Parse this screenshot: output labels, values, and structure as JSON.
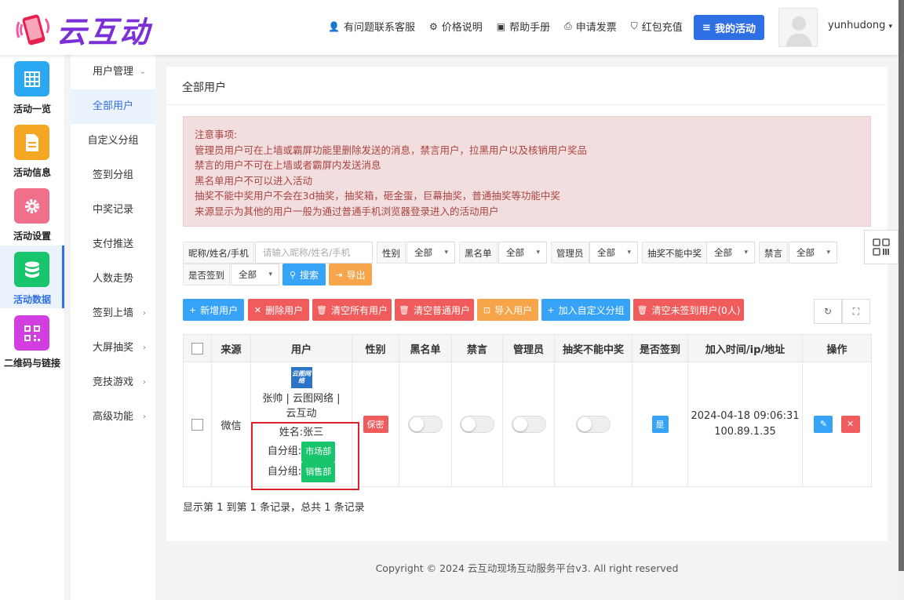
{
  "brand": {
    "name": "云互动"
  },
  "topnav": {
    "items": [
      {
        "label": "有问题联系客服",
        "icon": "user-add-icon"
      },
      {
        "label": "价格说明",
        "icon": "gear-icon"
      },
      {
        "label": "帮助手册",
        "icon": "book-icon"
      },
      {
        "label": "申请发票",
        "icon": "printer-icon"
      },
      {
        "label": "红包充值",
        "icon": "shield-icon"
      }
    ],
    "my_activity": "我的活动",
    "username": "yunhudong"
  },
  "iconcol": {
    "items": [
      {
        "label": "活动一览",
        "icon": "grid-icon",
        "color": "#2aa8f2"
      },
      {
        "label": "活动信息",
        "icon": "document-icon",
        "color": "#f5a623"
      },
      {
        "label": "活动设置",
        "icon": "gear-icon",
        "color": "#f0708c"
      },
      {
        "label": "活动数据",
        "icon": "database-icon",
        "color": "#18c56c"
      },
      {
        "label": "二维码与链接",
        "icon": "qrcode-icon",
        "color": "#d33ee0"
      }
    ]
  },
  "submenu": {
    "items": [
      "用户管理",
      "全部用户",
      "自定义分组",
      "签到分组",
      "中奖记录",
      "支付推送",
      "人数走势",
      "签到上墙",
      "大屏抽奖",
      "竞技游戏",
      "高级功能"
    ]
  },
  "panel": {
    "title": "全部用户"
  },
  "alert": {
    "lines": [
      "注意事项:",
      "管理员用户可在上墙或霸屏功能里删除发送的消息，禁言用户，拉黑用户以及核销用户奖品",
      "禁言的用户不可在上墙或者霸屏内发送消息",
      "黑名单用户不可以进入活动",
      "抽奖不能中奖用户不会在3d抽奖，抽奖箱，砸金蛋，巨幕抽奖，普通抽奖等功能中奖",
      "来源显示为其他的用户一般为通过普通手机浏览器登录进入的活动用户"
    ]
  },
  "filters": {
    "nickname_label": "昵称/姓名/手机",
    "nickname_placeholder": "请输入昵称/姓名/手机",
    "gender_label": "性别",
    "blacklist_label": "黑名单",
    "admin_label": "管理员",
    "no_win_label": "抽奖不能中奖",
    "mute_label": "禁言",
    "signed_label": "是否签到",
    "all": "全部",
    "search": "搜索",
    "export": "导出"
  },
  "actions": {
    "add_user": "新增用户",
    "delete_user": "删除用户",
    "clear_all": "清空所有用户",
    "clear_normal": "清空普通用户",
    "import_user": "导入用户",
    "add_group": "加入自定义分组",
    "clear_unsigned": "清空未签到用户(0人)"
  },
  "table": {
    "headers": [
      "来源",
      "用户",
      "性别",
      "黑名单",
      "禁言",
      "管理员",
      "抽奖不能中奖",
      "是否签到",
      "加入时间/ip/地址",
      "操作"
    ],
    "rows": [
      {
        "source": "微信",
        "logo_text": "云图网络",
        "nickname": "张帅 | 云图网络 | 云互动",
        "real_name": "姓名:张三",
        "group_label": "自分组:",
        "groups": [
          "市场部",
          "销售部"
        ],
        "gender": "保密",
        "signed": "是",
        "join_time": "2024-04-18 09:06:31",
        "ip": "100.89.1.35",
        "blacklist": false,
        "muted": false,
        "admin": false,
        "no_win": false
      }
    ]
  },
  "pager": {
    "text": "显示第 1 到第 1 条记录，总共 1 条记录"
  },
  "footer": {
    "text": "Copyright © 2024 云互动现场互动服务平台v3. All right reserved"
  },
  "colors": {
    "accent": "#2f6fe4",
    "brand": "#7b2fd6",
    "alert_bg": "#f2dede",
    "alert_text": "#a94442"
  }
}
